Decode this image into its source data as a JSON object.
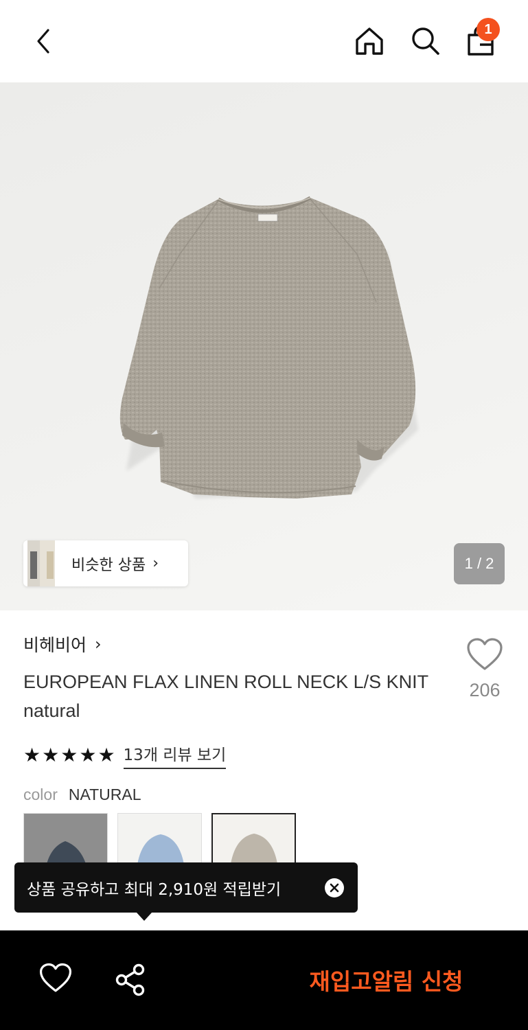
{
  "header": {
    "back_icon": "chevron-left-icon",
    "home_icon": "home-icon",
    "search_icon": "search-icon",
    "cart_icon": "shopping-bag-icon",
    "cart_count": "1"
  },
  "gallery": {
    "similar_label": "비슷한 상품",
    "pager": "1 / 2"
  },
  "product": {
    "brand": "비헤비어",
    "title": "EUROPEAN FLAX LINEN ROLL NECK L/S KNIT natural",
    "wish_count": "206",
    "rating_stars": 5,
    "review_link": "13개 리뷰 보기",
    "color_label": "color",
    "color_value": "NATURAL",
    "swatches": [
      {
        "color": "#4b5563"
      },
      {
        "color": "#9fb8d6"
      },
      {
        "color": "#bdb6aa"
      }
    ]
  },
  "tooltip": {
    "text": "상품 공유하고 최대 2,910원 적립받기"
  },
  "bottom_bar": {
    "cta_label": "재입고알림 신청",
    "accent_color": "#ff5a1f"
  }
}
